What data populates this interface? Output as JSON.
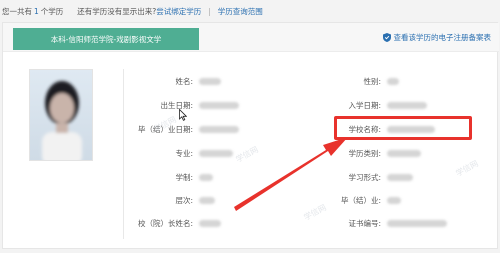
{
  "topbar": {
    "summary_prefix": "您一共有",
    "summary_count": "1",
    "summary_suffix": "个学历",
    "missing_prompt": "还有学历没有显示出来?",
    "bind_link": "尝试绑定学历",
    "divider": "|",
    "scope_link": "学历查询范围"
  },
  "tab": {
    "label": "本科-信阳师范学院-戏剧影视文学"
  },
  "header": {
    "ereg_link": "查看该学历的电子注册备案表"
  },
  "fields_left": [
    {
      "label": "姓名:"
    },
    {
      "label": "出生日期:"
    },
    {
      "label": "毕（结）业日期:"
    },
    {
      "label": "专业:"
    },
    {
      "label": "学制:"
    },
    {
      "label": "层次:"
    },
    {
      "label": "校（院）长姓名:"
    }
  ],
  "fields_right": [
    {
      "label": "性别:"
    },
    {
      "label": "入学日期:"
    },
    {
      "label": "学校名称:"
    },
    {
      "label": "学历类别:"
    },
    {
      "label": "学习形式:"
    },
    {
      "label": "毕（结）业:"
    },
    {
      "label": "证书编号:"
    }
  ],
  "watermark": "学信网",
  "colors": {
    "tab_green": "#4fae93",
    "link_blue": "#2a6fb0",
    "highlight_red": "#e8322c"
  },
  "icons": {
    "shield": "shield-icon",
    "cursor": "cursor-icon"
  }
}
